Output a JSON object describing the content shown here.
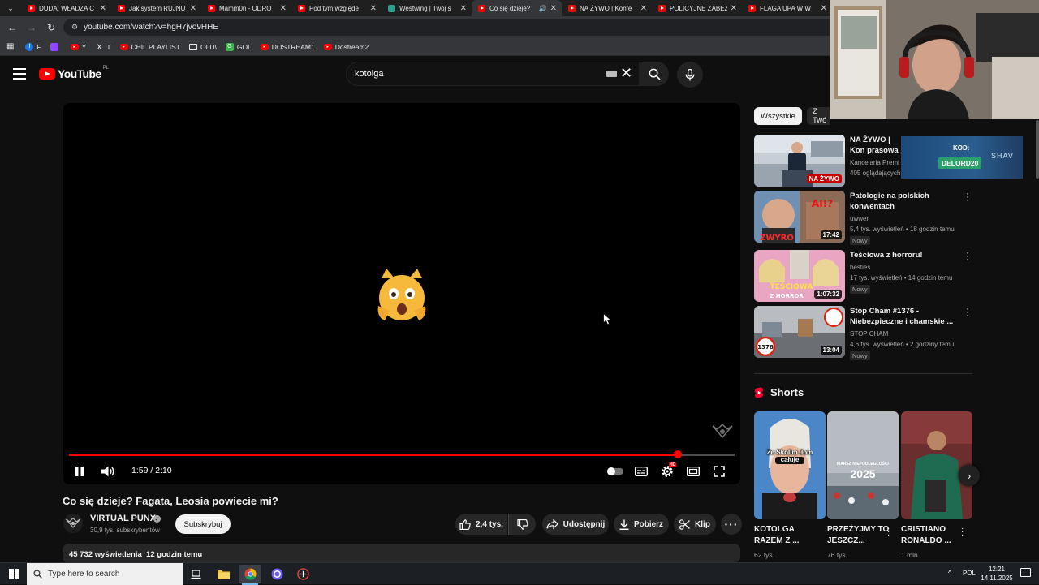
{
  "browser": {
    "tabs": [
      {
        "title": "DUDA: WŁADZA C",
        "active": false
      },
      {
        "title": "Jak system RUJNU",
        "active": false
      },
      {
        "title": "Mamm0n - ODRO",
        "active": false
      },
      {
        "title": "Pod tym względe",
        "active": false
      },
      {
        "title": "Westwing | Twój s",
        "active": false,
        "favicon": "westwing"
      },
      {
        "title": "Co się dzieje?",
        "active": true,
        "audio": true
      },
      {
        "title": "NA ŻYWO | Konfe",
        "active": false
      },
      {
        "title": "POLICYJNE ZABEZ",
        "active": false
      },
      {
        "title": "FLAGA UPA W W",
        "active": false
      }
    ],
    "url": "youtube.com/watch?v=hgH7jvo9HHE",
    "bookmarks": [
      {
        "label": "F",
        "icon": "facebook-icon",
        "color": "#1877f2"
      },
      {
        "label": "",
        "icon": "twitch-icon",
        "color": "#9146ff"
      },
      {
        "label": "Y",
        "icon": "youtube-icon",
        "color": "#ff0000"
      },
      {
        "label": "T",
        "icon": "x-icon",
        "color": "#000000"
      },
      {
        "label": "CHIL PLAYLIST",
        "icon": "youtube-icon",
        "color": "#ff0000"
      },
      {
        "label": "OLD\\",
        "icon": "folder-icon",
        "color": "#e8e8e8"
      },
      {
        "label": "GOL",
        "icon": "gol-icon",
        "color": "#39b54a"
      },
      {
        "label": "DOSTREAM1",
        "icon": "youtube-icon",
        "color": "#ff0000"
      },
      {
        "label": "Dostream2",
        "icon": "youtube-icon",
        "color": "#ff0000"
      }
    ]
  },
  "youtube": {
    "logo_text": "YouTube",
    "country_code": "PL",
    "search_value": "kotolga",
    "accent_red": "#ff0000"
  },
  "player": {
    "current_time": "1:59",
    "duration": "2:10",
    "time_display": "1:59 / 2:10",
    "progress": 0.915,
    "center_emoji": "weary-cat-face",
    "settings_badge": "HD"
  },
  "video": {
    "title": "Co się dzieje? Fagata, Leosia powiecie mi?",
    "channel": "VIRTUAL PUNX",
    "subscribers": "30,9 tys. subskrybentów",
    "subscribe_label": "Subskrybuj",
    "likes": "2,4 tys.",
    "share_label": "Udostępnij",
    "download_label": "Pobierz",
    "clip_label": "Klip",
    "views_line": "45 732 wyświetlenia  12 godzin temu"
  },
  "sidebar": {
    "chips": [
      "Wszystkie",
      "Z Twó"
    ],
    "recommendations": [
      {
        "title": "NA ŻYWO | Konferencja prasowa Premiera",
        "title_visible": "NA ŻYWO | Kon prasowa Premi",
        "channel": "Kancelaria Premi",
        "meta": "405 oglądających",
        "badge": "",
        "duration": "NA ŻYWO",
        "live": true
      },
      {
        "title": "Patologie na polskich konwentach",
        "channel": "uwwer",
        "meta": "5,4 tys. wyświetleń • 18 godzin temu",
        "badge": "Nowy",
        "duration": "17:42",
        "live": false
      },
      {
        "title": "Teściowa z horroru!",
        "channel": "besties",
        "meta": "17 tys. wyświetleń • 14 godzin temu",
        "badge": "Nowy",
        "duration": "1:07:32",
        "live": false
      },
      {
        "title": "Stop Cham #1376 - Niebezpieczne i chamskie ...",
        "channel": "STOP CHAM",
        "meta": "4,6 tys. wyświetleń • 2 godziny temu",
        "badge": "Nowy",
        "duration": "13:04",
        "live": false
      }
    ],
    "shorts_heading": "Shorts",
    "shorts": [
      {
        "title": "KOTOLGA RAZEM Z ...",
        "views": "62 tys.",
        "overlay": "Ze Skolim Jom całuje"
      },
      {
        "title": "PRZEŻYJMY TO JESZCZ...",
        "views": "76 tys.",
        "overlay": "2025",
        "overlay_small": "MARSZ NIEPODLEGŁOŚCI"
      },
      {
        "title": "CRISTIANO RONALDO ...",
        "views": "1 mln",
        "overlay": ""
      }
    ],
    "promo": {
      "label": "KOD:",
      "code": "DELORD20",
      "brand": "SHAV"
    }
  },
  "taskbar": {
    "search_placeholder": "Type here to search",
    "language": "POL",
    "time": "12:21",
    "date": "14.11.2025"
  }
}
